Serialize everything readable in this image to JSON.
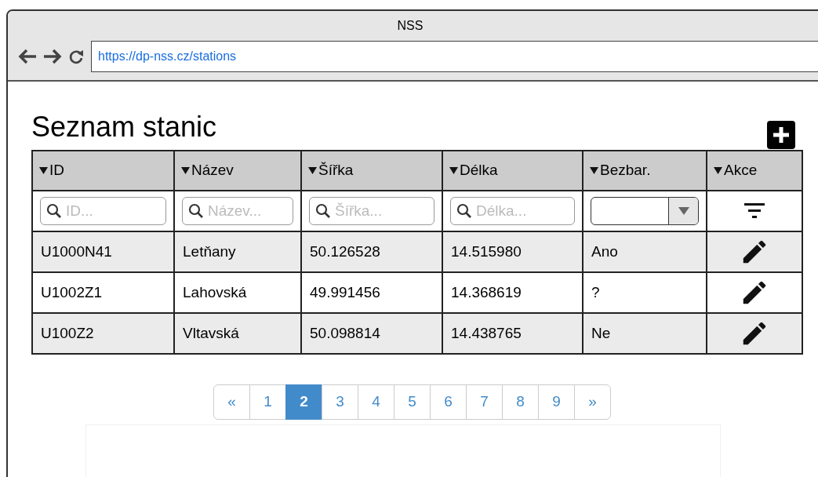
{
  "window": {
    "title": "NSS"
  },
  "address_bar": {
    "url": "https://dp-nss.cz/stations"
  },
  "page": {
    "heading": "Seznam stanic"
  },
  "table": {
    "columns": [
      "ID",
      "Název",
      "Šířka",
      "Délka",
      "Bezbar.",
      "Akce"
    ],
    "filters": [
      {
        "kind": "search",
        "placeholder": "ID..."
      },
      {
        "kind": "search",
        "placeholder": "Název..."
      },
      {
        "kind": "search",
        "placeholder": "Šířka..."
      },
      {
        "kind": "search",
        "placeholder": "Délka..."
      },
      {
        "kind": "select"
      },
      {
        "kind": "filter"
      }
    ],
    "rows": [
      [
        "U1000N41",
        "Letňany",
        "50.126528",
        "14.515980",
        "Ano"
      ],
      [
        "U1002Z1",
        "Lahovská",
        "49.991456",
        "14.368619",
        "?"
      ],
      [
        "U100Z2",
        "Vltavská",
        "50.098814",
        "14.438765",
        "Ne"
      ]
    ]
  },
  "pagination": [
    {
      "label": "«",
      "selected": false
    },
    {
      "label": "1",
      "selected": false
    },
    {
      "label": "2",
      "selected": true
    },
    {
      "label": "3",
      "selected": false
    },
    {
      "label": "4",
      "selected": false
    },
    {
      "label": "5",
      "selected": false
    },
    {
      "label": "6",
      "selected": false
    },
    {
      "label": "7",
      "selected": false
    },
    {
      "label": "8",
      "selected": false
    },
    {
      "label": "9",
      "selected": false
    },
    {
      "label": "»",
      "selected": false
    }
  ]
}
